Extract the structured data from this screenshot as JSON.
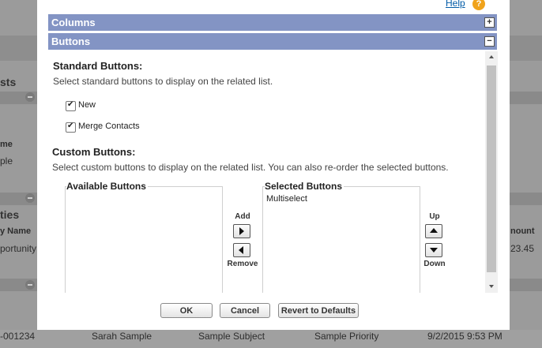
{
  "background": {
    "related_lists_fragment": "sts",
    "name_col_fragment": "me",
    "sample_fragment": "ple",
    "opportunities_fragment": "ties",
    "opp_name_col_fragment": "y Name",
    "opportunity_fragment": "portunity",
    "amount_col_fragment": "nount",
    "amount_value_fragment": "23.45",
    "case_row": {
      "number": "-001234",
      "contact": "Sarah Sample",
      "subject": "Sample Subject",
      "priority": "Sample Priority",
      "date": "9/2/2015 9:53 PM"
    }
  },
  "dialog": {
    "help_label": "Help",
    "help_icon": "question-icon",
    "sections": [
      {
        "title": "Columns",
        "toggle": "+"
      },
      {
        "title": "Buttons",
        "toggle": "−"
      }
    ],
    "standard_buttons": {
      "heading": "Standard Buttons:",
      "description": "Select standard buttons to display on the related list.",
      "options": [
        {
          "label": "New",
          "checked": true
        },
        {
          "label": "Merge Contacts",
          "checked": true
        }
      ]
    },
    "custom_buttons": {
      "heading": "Custom Buttons:",
      "description": "Select custom buttons to display on the related list. You can also re-order the selected buttons.",
      "available_title": "Available Buttons",
      "available_items": [],
      "selected_title": "Selected Buttons",
      "selected_items": [
        "Multiselect"
      ],
      "add_label": "Add",
      "remove_label": "Remove",
      "up_label": "Up",
      "down_label": "Down"
    },
    "footer": {
      "ok_label": "OK",
      "cancel_label": "Cancel",
      "revert_label": "Revert to Defaults"
    }
  },
  "colors": {
    "section_bar": "#8394c4",
    "link": "#015ba7",
    "help_icon": "#f0a31c"
  }
}
